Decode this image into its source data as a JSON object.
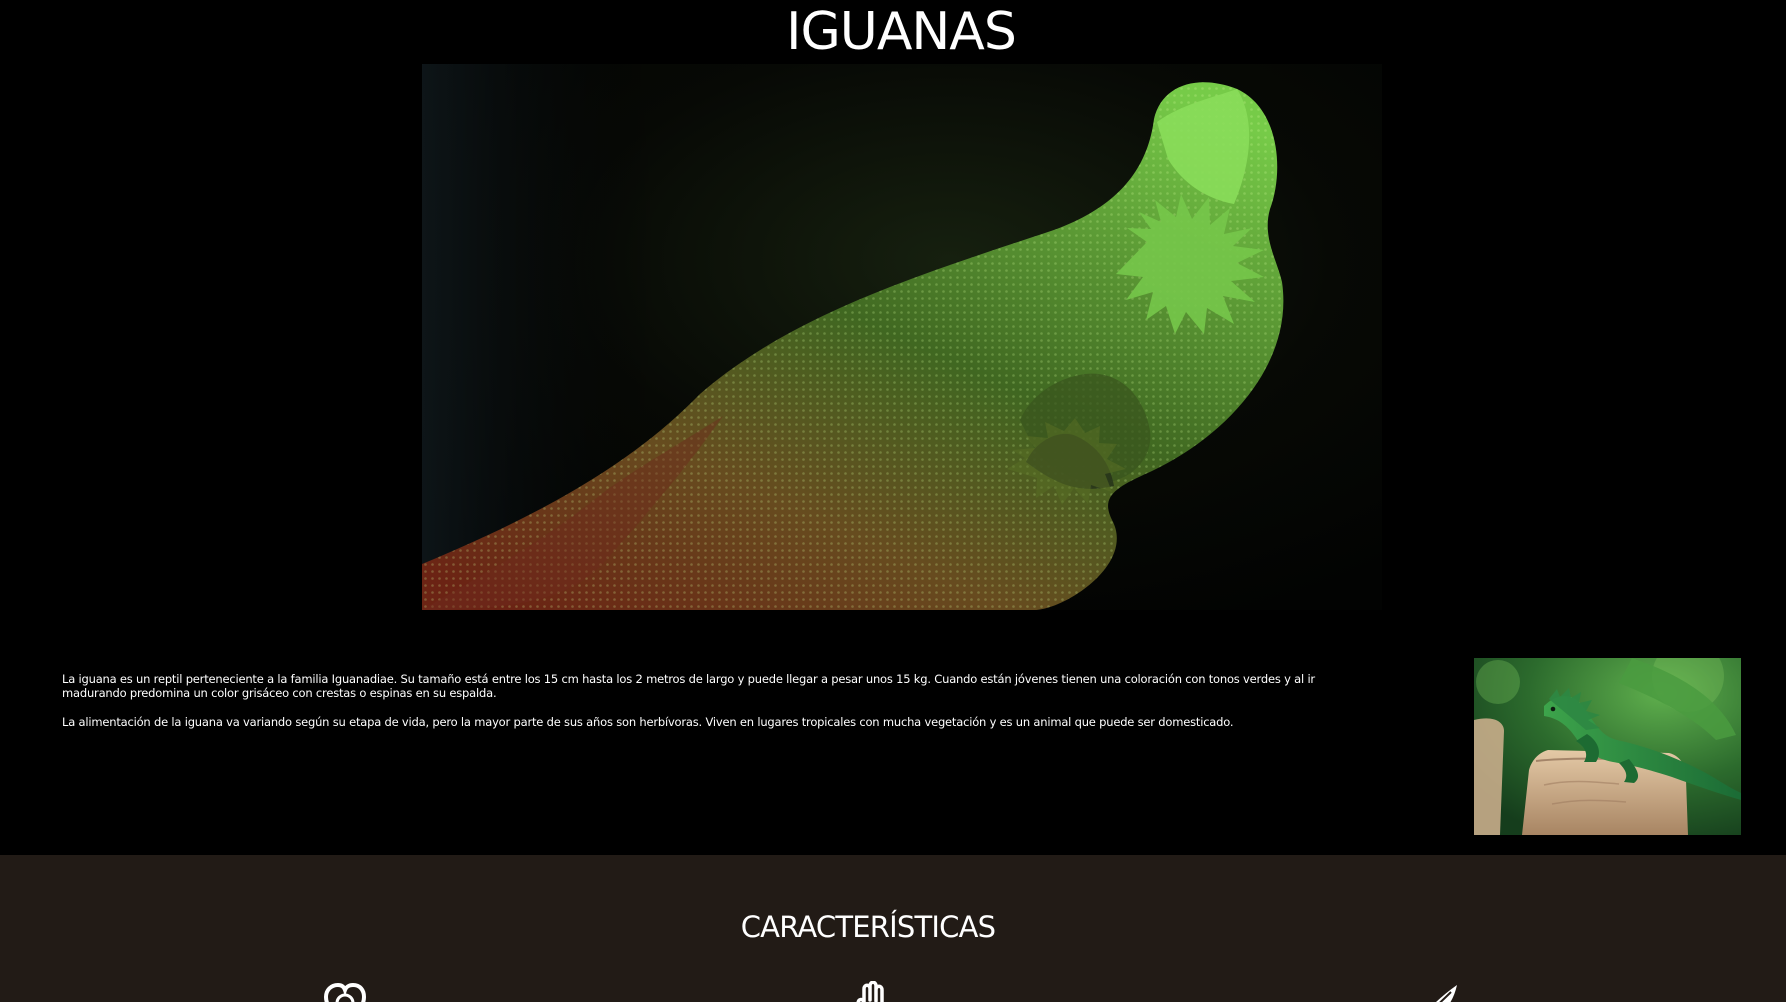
{
  "header": {
    "title": "IGUANAS"
  },
  "hero": {
    "image_subject": "bearded dragon in dramatic green lighting"
  },
  "intro": {
    "paragraph_1": "La iguana es un reptil perteneciente a la familia Iguanadiae. Su tamaño está entre los 15 cm hasta los 2 metros de largo y puede llegar a pesar unos 15 kg. Cuando están jóvenes tienen una coloración con tonos verdes y al ir madurando predomina un color grisáceo con crestas o espinas en su espalda.",
    "paragraph_2": "La alimentación de la iguana va variando según su etapa de vida, pero la mayor parte de sus años son herbívoras. Viven en lugares tropicales con mucha vegetación y es un animal que puede ser domesticado.",
    "thumbnail_subject": "green iguana on a tree stump"
  },
  "features": {
    "title": "CARACTERÍSTICAS",
    "icons": [
      "heart-icon",
      "hand-icon",
      "feather-icon"
    ]
  },
  "colors": {
    "page_background": "#000000",
    "features_background": "#221b16",
    "text": "#ffffff"
  }
}
